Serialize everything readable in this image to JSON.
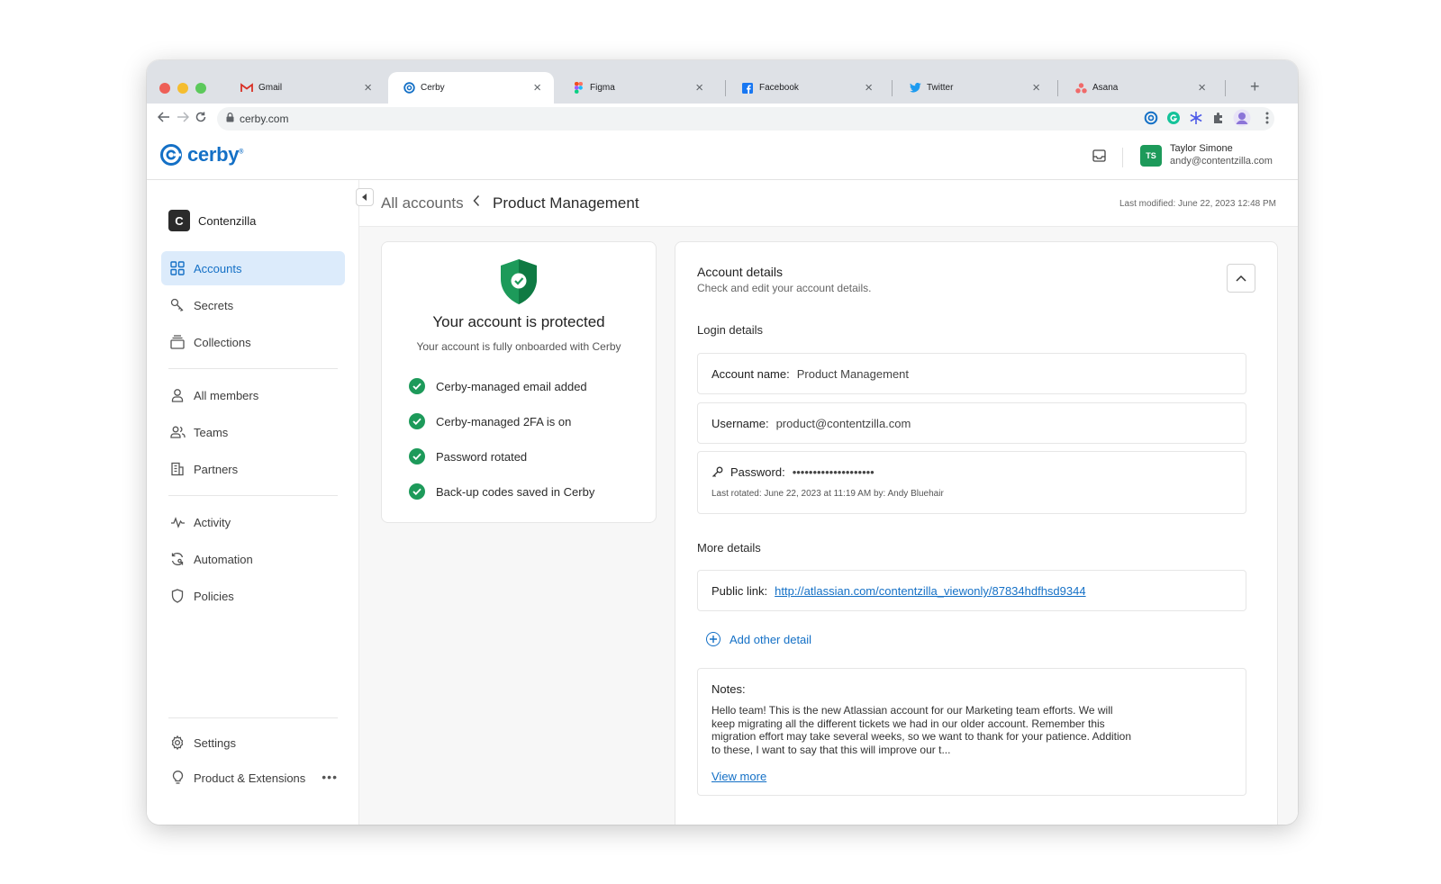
{
  "browser": {
    "tabs": [
      {
        "label": "Gmail",
        "icon": "gmail-icon",
        "active": false
      },
      {
        "label": "Cerby",
        "icon": "cerby-icon",
        "active": true
      },
      {
        "label": "Figma",
        "icon": "figma-icon",
        "active": false
      },
      {
        "label": "Facebook",
        "icon": "facebook-icon",
        "active": false
      },
      {
        "label": "Twitter",
        "icon": "twitter-icon",
        "active": false
      },
      {
        "label": "Asana",
        "icon": "asana-icon",
        "active": false
      }
    ],
    "new_tab": "+",
    "close_glyph": "×",
    "url": "cerby.com"
  },
  "header": {
    "brand": "cerby",
    "brand_mark": "®",
    "user": {
      "initials": "TS",
      "name": "Taylor Simone",
      "email": "andy@contentzilla.com"
    },
    "colors": {
      "brand": "#1470c6",
      "avatar": "#1d9a5a"
    }
  },
  "sidebar": {
    "org_initial": "C",
    "org_name": "Contenzilla",
    "items": [
      {
        "label": "Accounts",
        "icon": "grid-icon",
        "active": true
      },
      {
        "label": "Secrets",
        "icon": "key-icon"
      },
      {
        "label": "Collections",
        "icon": "stack-icon"
      },
      {
        "label": "All members",
        "icon": "user-icon"
      },
      {
        "label": "Teams",
        "icon": "users-icon"
      },
      {
        "label": "Partners",
        "icon": "building-icon"
      },
      {
        "label": "Activity",
        "icon": "activity-icon"
      },
      {
        "label": "Automation",
        "icon": "automation-icon"
      },
      {
        "label": "Policies",
        "icon": "shield-outline-icon"
      },
      {
        "label": "Settings",
        "icon": "gear-icon"
      },
      {
        "label": "Product & Extensions",
        "icon": "lightbulb-icon",
        "more": "•••"
      }
    ]
  },
  "page": {
    "breadcrumb_root": "All accounts",
    "breadcrumb_current": "Product Management",
    "last_modified": "Last modified: June 22, 2023 12:48 PM"
  },
  "protection": {
    "title": "Your account is protected",
    "subtitle": "Your account is fully onboarded with Cerby",
    "checks": [
      "Cerby-managed email added",
      "Cerby-managed 2FA is on",
      "Password rotated",
      "Back-up codes saved in Cerby"
    ],
    "color": "#1d9a5a"
  },
  "details": {
    "title": "Account details",
    "subtitle": "Check and edit your account details.",
    "login_heading": "Login details",
    "account_name_label": "Account name:",
    "account_name": "Product Management",
    "username_label": "Username:",
    "username": "product@contentzilla.com",
    "password_label": "Password:",
    "password_mask": "••••••••••••••••••••",
    "password_rotated": "Last rotated: June 22, 2023 at 11:19 AM by: Andy Bluehair",
    "more_heading": "More details",
    "public_link_label": "Public link:",
    "public_link": "http://atlassian.com/contentzilla_viewonly/87834hdfhsd9344",
    "add_detail": "Add other detail",
    "notes_label": "Notes:",
    "notes": "Hello team! This is the new Atlassian account for our Marketing team efforts. We will keep migrating all the different tickets we had in our older account. Remember this migration effort may take several weeks, so we want to thank for your patience. Addition to these, I want to say that this will improve our t...",
    "view_more": "View more"
  }
}
